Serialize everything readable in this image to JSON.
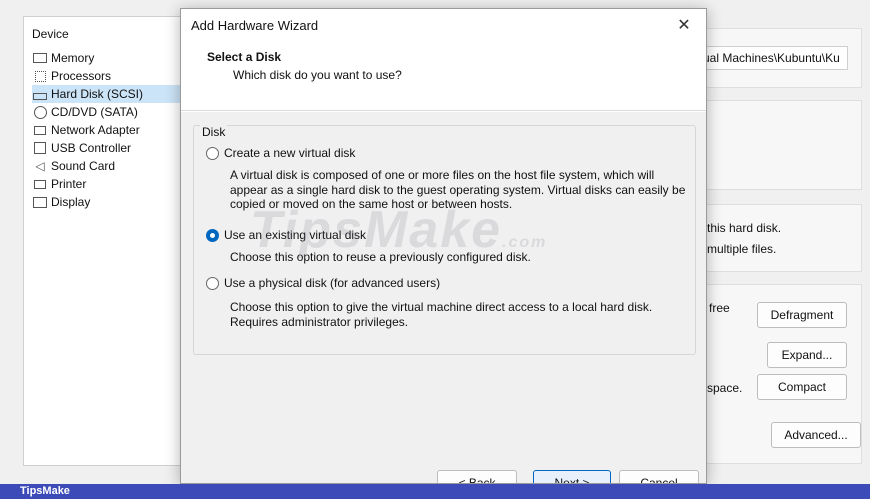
{
  "settings": {
    "device_header": "Device",
    "devices": [
      {
        "label": "Memory",
        "icon": "memory-icon"
      },
      {
        "label": "Processors",
        "icon": "processor-icon"
      },
      {
        "label": "Hard Disk (SCSI)",
        "icon": "hard-disk-icon",
        "selected": true
      },
      {
        "label": "CD/DVD (SATA)",
        "icon": "cd-dvd-icon"
      },
      {
        "label": "Network Adapter",
        "icon": "network-adapter-icon"
      },
      {
        "label": "USB Controller",
        "icon": "usb-icon"
      },
      {
        "label": "Sound Card",
        "icon": "speaker-icon"
      },
      {
        "label": "Printer",
        "icon": "printer-icon"
      },
      {
        "label": "Display",
        "icon": "display-icon"
      }
    ],
    "disk_file_path": "ual Machines\\Kubuntu\\Ku",
    "info_line1": "this hard disk.",
    "info_line2": "multiple files.",
    "free_text": "free",
    "space_text": "space.",
    "defragment_label": "Defragment",
    "expand_label": "Expand...",
    "compact_label": "Compact",
    "advanced_label": "Advanced..."
  },
  "dialog": {
    "title": "Add Hardware Wizard",
    "close_glyph": "✕",
    "header_title": "Select a Disk",
    "header_subtitle": "Which disk do you want to use?",
    "group_label": "Disk",
    "options": [
      {
        "label": "Create a new virtual disk",
        "checked": false,
        "description": "A virtual disk is composed of one or more files on the host file system, which will appear as a single hard disk to the guest operating system. Virtual disks can easily be copied or moved on the same host or between hosts."
      },
      {
        "label": "Use an existing virtual disk",
        "checked": true,
        "description": "Choose this option to reuse a previously configured disk."
      },
      {
        "label": "Use a physical disk (for advanced users)",
        "checked": false,
        "description": "Choose this option to give the virtual machine direct access to a local hard disk. Requires administrator privileges."
      }
    ],
    "back_label": "< Back",
    "next_label": "Next >",
    "cancel_label": "Cancel"
  },
  "watermark": {
    "main": "TipsMake",
    "suffix": ".com"
  },
  "footer": {
    "brand": "TipsMake"
  },
  "colors": {
    "accent": "#0067c0",
    "footer_bar": "#3d4bb8",
    "selection": "#cce4f7"
  }
}
